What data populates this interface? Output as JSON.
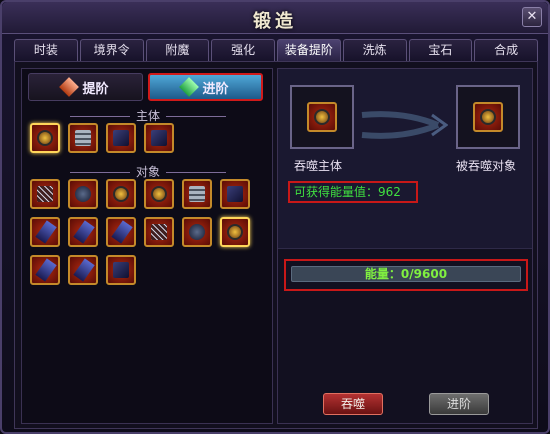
{
  "window": {
    "title": "锻造",
    "close_glyph": "✕"
  },
  "tabs": [
    {
      "label": "时装"
    },
    {
      "label": "境界令"
    },
    {
      "label": "附魔"
    },
    {
      "label": "强化"
    },
    {
      "label": "装备提阶",
      "active": true
    },
    {
      "label": "洗炼"
    },
    {
      "label": "宝石"
    },
    {
      "label": "合成"
    }
  ],
  "subtabs": {
    "promote": "提阶",
    "advance": "进阶",
    "active": "advance"
  },
  "sections": {
    "main": "主体",
    "target": "对象"
  },
  "main_items": [
    {
      "icon": "ring-icon",
      "kind": "ring",
      "selected": true
    },
    {
      "icon": "armor-icon",
      "kind": "armor"
    },
    {
      "icon": "bat-wing-icon",
      "kind": "bat"
    },
    {
      "icon": "bat-wing-icon",
      "kind": "bat"
    }
  ],
  "target_items": [
    {
      "icon": "web-icon",
      "kind": "web"
    },
    {
      "icon": "orb-icon",
      "kind": "orb"
    },
    {
      "icon": "ring-icon",
      "kind": "ring"
    },
    {
      "icon": "ring-icon",
      "kind": "ring"
    },
    {
      "icon": "armor-icon",
      "kind": "armor"
    },
    {
      "icon": "bat-wing-icon",
      "kind": "bat"
    },
    {
      "icon": "blade-icon",
      "kind": "blade"
    },
    {
      "icon": "blade-icon",
      "kind": "blade"
    },
    {
      "icon": "blade-icon",
      "kind": "blade"
    },
    {
      "icon": "web-icon",
      "kind": "web"
    },
    {
      "icon": "orb-icon",
      "kind": "orb"
    },
    {
      "icon": "ring-icon",
      "kind": "ring",
      "selected": true
    },
    {
      "icon": "blade-icon",
      "kind": "blade"
    },
    {
      "icon": "blade-icon",
      "kind": "blade"
    },
    {
      "icon": "bat-wing-icon",
      "kind": "bat"
    }
  ],
  "devour": {
    "subject_label": "吞噬主体",
    "target_label": "被吞噬对象",
    "energy_gain_text": "可获得能量值：962",
    "energy_bar_text": "能量：0/9600",
    "energy_current": 0,
    "energy_max": 9600
  },
  "buttons": {
    "devour": "吞噬",
    "advance": "进阶"
  },
  "colors": {
    "highlight_border": "#c81818",
    "energy_text": "#40e040"
  }
}
